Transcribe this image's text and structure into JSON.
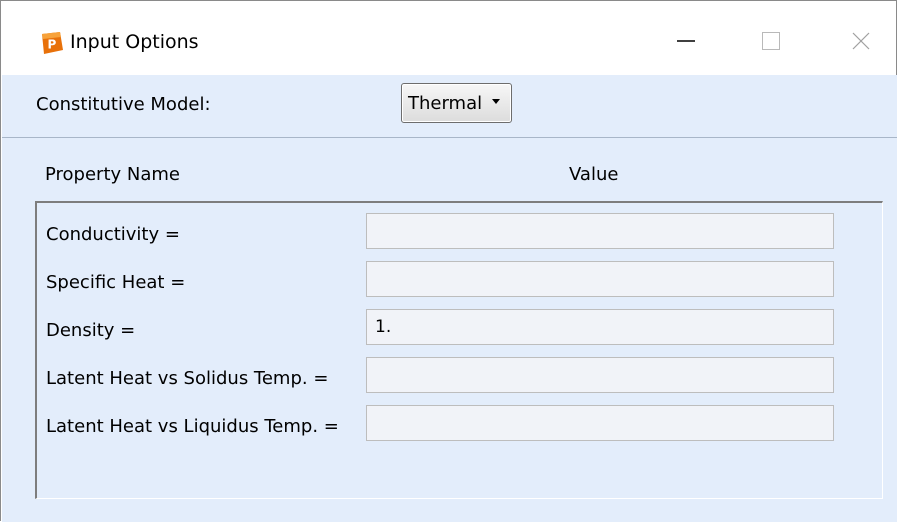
{
  "window": {
    "title": "Input Options",
    "icon": "app-logo-icon",
    "accent_color": "#e8710a"
  },
  "upper": {
    "constitutive_model_label": "Constitutive Model:",
    "constitutive_model_value": "Thermal"
  },
  "table": {
    "header_name": "Property Name",
    "header_value": "Value",
    "rows": [
      {
        "label": "Conductivity =",
        "value": ""
      },
      {
        "label": "Specific Heat =",
        "value": ""
      },
      {
        "label": "Density =",
        "value": "1."
      },
      {
        "label": "Latent Heat vs Solidus Temp. =",
        "value": ""
      },
      {
        "label": "Latent Heat vs Liquidus Temp. =",
        "value": ""
      }
    ]
  },
  "colors": {
    "panel_bg": "#e3edfb",
    "input_bg": "#f1f3f8"
  }
}
